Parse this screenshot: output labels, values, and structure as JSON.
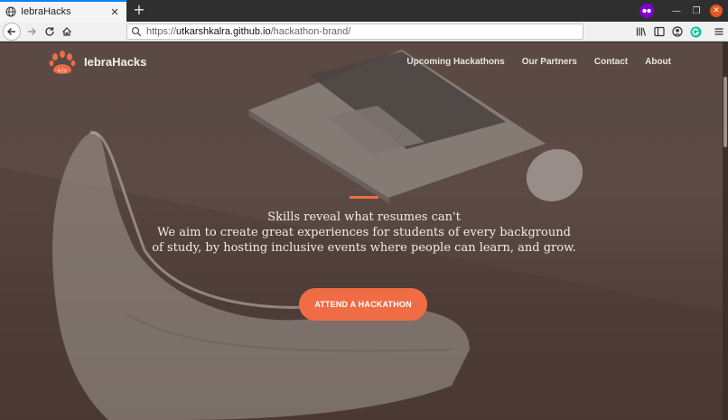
{
  "browser": {
    "tab_title": "IebraHacks",
    "url_prefix": "https://",
    "url_host": "utkarshkalra.github.io",
    "url_path": "/hackathon-brand/"
  },
  "site": {
    "brand": "IebraHacks",
    "nav": [
      "Upcoming Hackathons",
      "Our Partners",
      "Contact",
      "About"
    ],
    "tagline": "Skills reveal what resumes can't",
    "description": "We aim to create great experiences for students of every background of study, by hosting inclusive events where people can learn, and grow.",
    "cta_label": "ATTEND A HACKATHON"
  },
  "colors": {
    "accent": "#ef6c45",
    "page_overlay": "#5a4a43",
    "text": "#f1ece9"
  }
}
